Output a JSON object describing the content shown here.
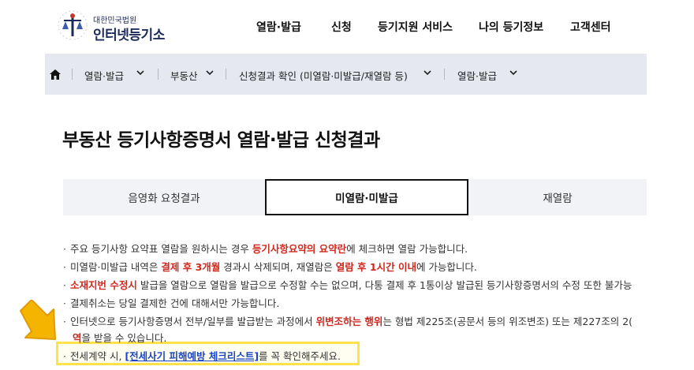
{
  "logo": {
    "subtitle": "대한민국법원",
    "title": "인터넷등기소",
    "icon": "court-emblem-icon"
  },
  "nav": {
    "items": [
      "열람·발급",
      "신청",
      "등기지원 서비스",
      "나의 등기정보",
      "고객센터"
    ]
  },
  "breadcrumb": {
    "home_icon": "home-icon",
    "items": [
      "열람·발급",
      "부동산",
      "신청결과 확인 (미열람·미발급/재열람 등)",
      "열람·발급"
    ]
  },
  "page": {
    "title": "부동산 등기사항증명서 열람·발급 신청결과"
  },
  "tabs": [
    {
      "label": "음영화 요청결과",
      "active": false
    },
    {
      "label": "미열람·미발급",
      "active": true
    },
    {
      "label": "재열람",
      "active": false
    }
  ],
  "notes": {
    "n1": {
      "a": "주요 등기사항 요약표 열람을 원하시는 경우 ",
      "b": "등기사항요약의 요약란",
      "c": "에 체크하면 열람 가능합니다."
    },
    "n2": {
      "a": "미열람·미발급 내역은 ",
      "b": "결제 후 3개월",
      "c": " 경과시 삭제되며, 재열람은 ",
      "d": "열람 후 1시간 이내",
      "e": "에 가능합니다."
    },
    "n3": {
      "a": "소재지번 수정시",
      "b": " 발급을 열람으로 열람을 발급으로 수정할 수는 없으며, 다통 결제 후 1통이상 발급된 등기사항증명서의 수정 또한 불가능"
    },
    "n4": {
      "a": "결제취소는 당일 결제한 건에 대해서만 가능합니다."
    },
    "n5": {
      "a": "인터넷으로 등기사항증명서 전부/일부를 발급받는 과정에서 ",
      "b": "위변조하는 행위",
      "c": "는 형법 제225조(공문서 등의 위조변조) 또는 제227조의 2(",
      "d": "역",
      "e": "을 받을 수 있습니다."
    },
    "n6": {
      "a": "전세계약 시, ",
      "link": "[전세사기 피해예방 체크리스트]",
      "c": "를 꼭 확인해주세요."
    }
  },
  "colors": {
    "red": "#d0281e",
    "link": "#1a45c8",
    "highlight": "#ffe24a",
    "arrow": "#f5b400",
    "bar": "#e5e8ef"
  },
  "annotation": {
    "arrow_icon": "pointing-arrow-icon"
  }
}
